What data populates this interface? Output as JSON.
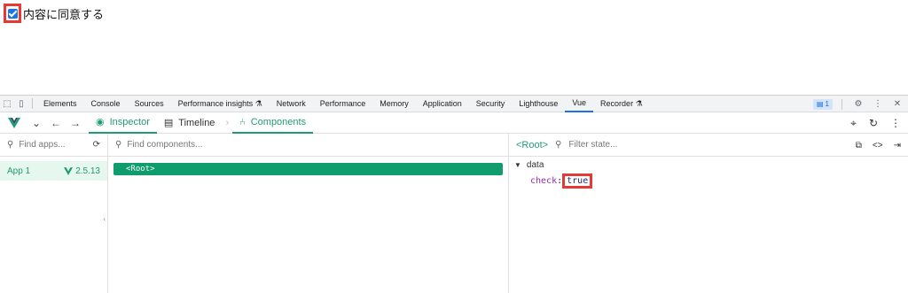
{
  "page": {
    "consent_label": "内容に同意する",
    "consent_checked": true,
    "highlight_color": "#e53935"
  },
  "devtools_tabs": [
    {
      "label": "Elements"
    },
    {
      "label": "Console"
    },
    {
      "label": "Sources"
    },
    {
      "label": "Performance insights ⚗"
    },
    {
      "label": "Network"
    },
    {
      "label": "Performance"
    },
    {
      "label": "Memory"
    },
    {
      "label": "Application"
    },
    {
      "label": "Security"
    },
    {
      "label": "Lighthouse"
    },
    {
      "label": "Vue"
    },
    {
      "label": "Recorder ⚗"
    }
  ],
  "devtools_active_tab": "Vue",
  "issues_count": "1",
  "vue_toolbar": {
    "inspector_label": "Inspector",
    "timeline_label": "Timeline",
    "components_label": "Components"
  },
  "apps": {
    "search_placeholder": "Find apps...",
    "items": [
      {
        "name": "App 1",
        "version": "2.5.13"
      }
    ]
  },
  "components": {
    "search_placeholder": "Find components...",
    "root_label": "<Root>"
  },
  "state_panel": {
    "component_name": "<Root>",
    "filter_placeholder": "Filter state...",
    "section": "data",
    "props": [
      {
        "key": "check",
        "value": "true"
      }
    ]
  },
  "colors": {
    "vue_green": "#1f9d72",
    "root_row_bg": "#0f9d6e",
    "active_tab_underline": "#1a73e8"
  }
}
